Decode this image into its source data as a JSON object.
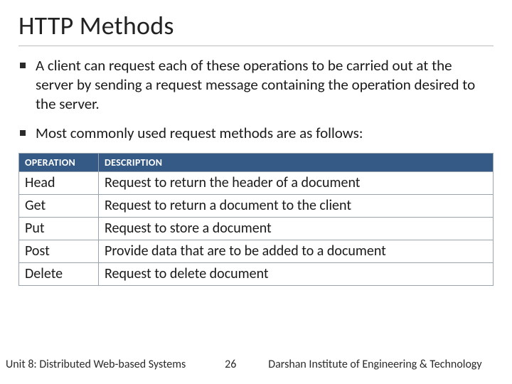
{
  "title": "HTTP Methods",
  "bullets": [
    "A client can request each of these operations to be carried out at the server by sending a request message containing the operation desired to the server.",
    "Most commonly used request methods are as follows:"
  ],
  "table": {
    "headers": {
      "op": "OPERATION",
      "desc": "DESCRIPTION"
    },
    "rows": [
      {
        "op": "Head",
        "desc": "Request to return the header of a document"
      },
      {
        "op": "Get",
        "desc": "Request to return a document to the client"
      },
      {
        "op": "Put",
        "desc": "Request to store a document"
      },
      {
        "op": "Post",
        "desc": "Provide data that are to be added to a document"
      },
      {
        "op": "Delete",
        "desc": "Request to delete document"
      }
    ]
  },
  "footer": {
    "unit": "Unit 8: Distributed Web-based Systems",
    "page": "26",
    "institute": "Darshan Institute of Engineering & Technology"
  }
}
